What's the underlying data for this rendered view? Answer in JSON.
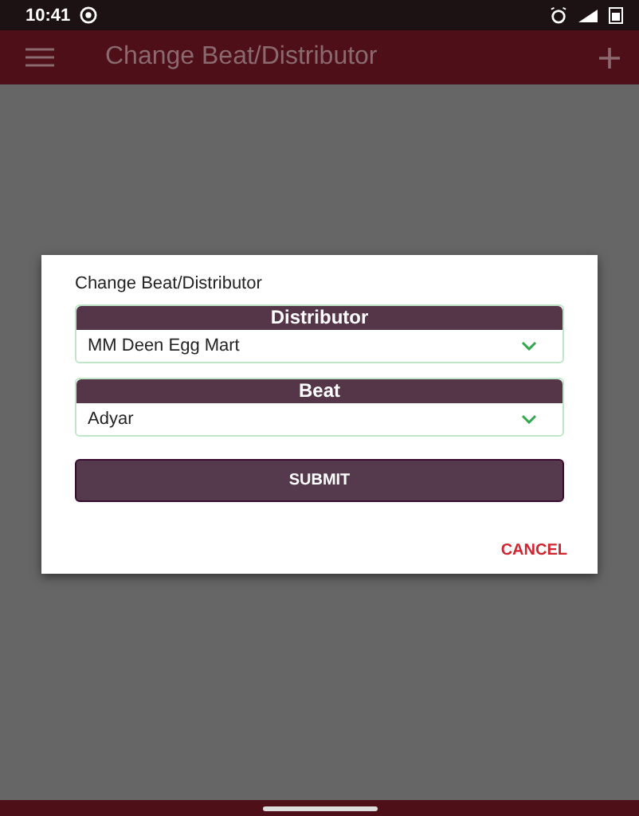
{
  "status_bar": {
    "time": "10:41"
  },
  "app_bar": {
    "title": "Change Beat/Distributor"
  },
  "dialog": {
    "title": "Change Beat/Distributor",
    "fields": [
      {
        "label": "Distributor",
        "value": "MM Deen Egg Mart"
      },
      {
        "label": "Beat",
        "value": "Adyar"
      }
    ],
    "submit": "SUBMIT",
    "cancel": "CANCEL"
  }
}
